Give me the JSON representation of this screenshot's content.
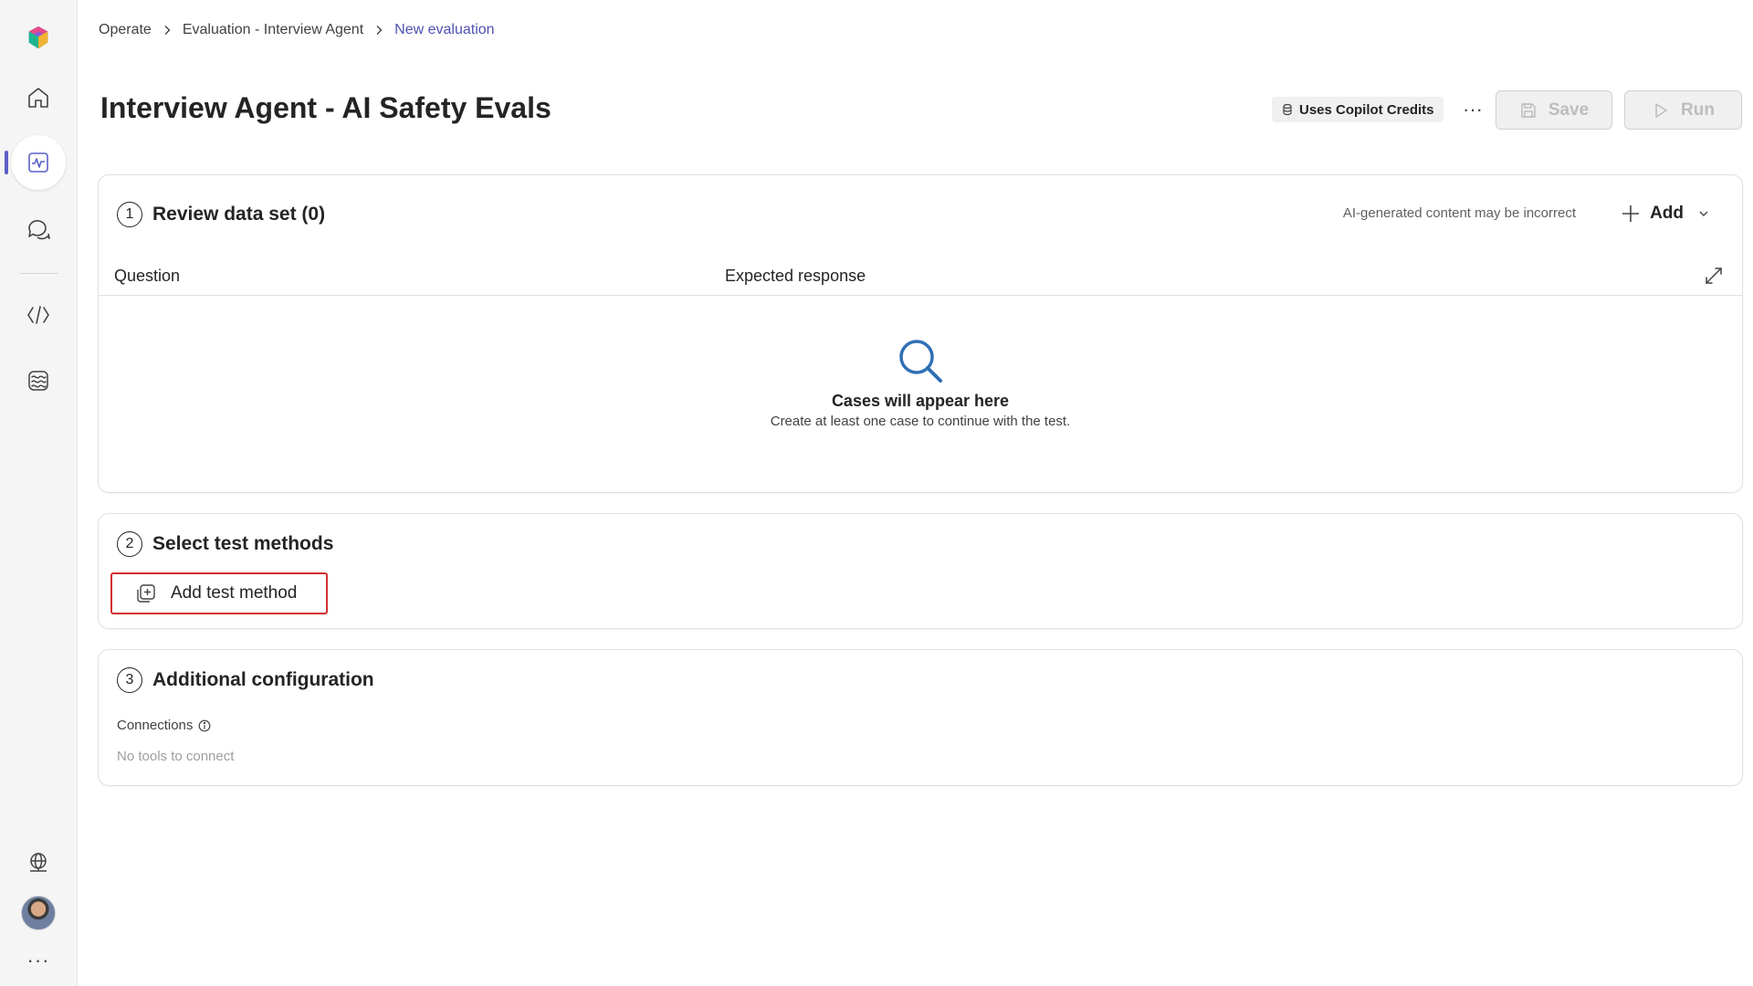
{
  "rail": {
    "items": [
      {
        "name": "home"
      },
      {
        "name": "evaluation",
        "active": true
      },
      {
        "name": "chat"
      },
      {
        "name": "code"
      },
      {
        "name": "brain"
      }
    ],
    "more": "···"
  },
  "breadcrumb": {
    "items": [
      "Operate",
      "Evaluation - Interview Agent",
      "New evaluation"
    ]
  },
  "header": {
    "title": "Interview Agent - AI Safety Evals",
    "credits_badge": "Uses Copilot Credits",
    "more": "···",
    "save_label": "Save",
    "run_label": "Run"
  },
  "section1": {
    "number": "1",
    "title": "Review data set (0)",
    "ai_note": "AI-generated content may be incorrect",
    "add_label": "Add",
    "columns": [
      "Question",
      "Expected response"
    ],
    "empty_title": "Cases will appear here",
    "empty_subtitle": "Create at least one case to continue with the test."
  },
  "section2": {
    "number": "2",
    "title": "Select test methods",
    "add_method_label": "Add test method"
  },
  "section3": {
    "number": "3",
    "title": "Additional configuration",
    "connections_label": "Connections",
    "connections_empty": "No tools to connect"
  },
  "colors": {
    "accent": "#5b5fc7",
    "breadcrumb_current": "#4f52b2",
    "highlight_border": "#d32f2f"
  }
}
